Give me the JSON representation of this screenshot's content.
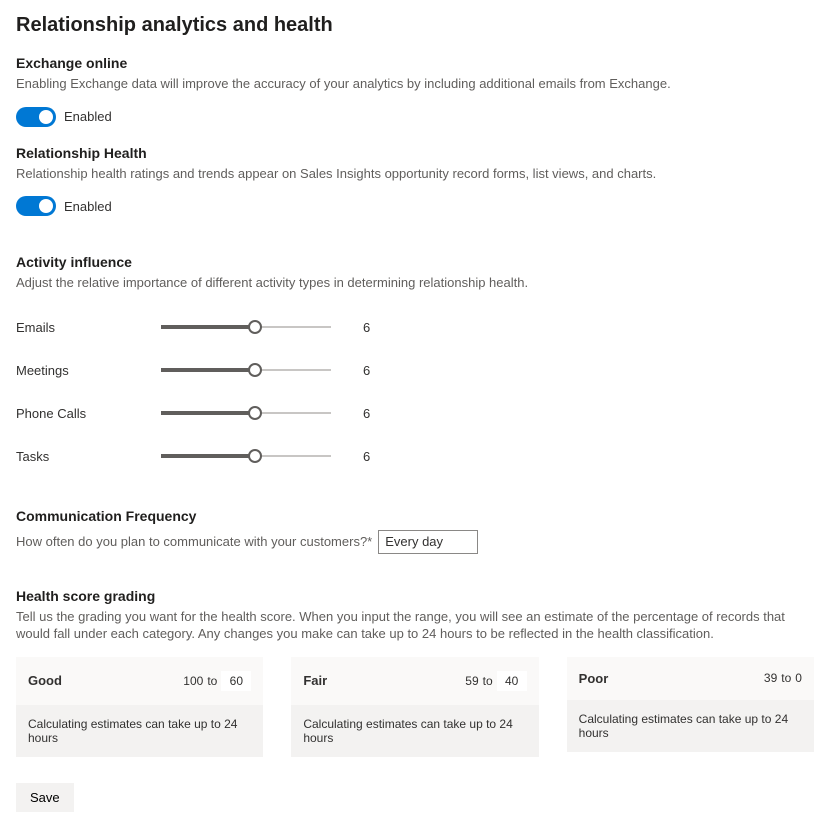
{
  "page_title": "Relationship analytics and health",
  "exchange": {
    "title": "Exchange online",
    "desc": "Enabling Exchange data will improve the accuracy of your analytics by including additional emails from Exchange.",
    "toggle_label": "Enabled"
  },
  "rel_health": {
    "title": "Relationship Health",
    "desc": "Relationship health ratings and trends appear on Sales Insights opportunity record forms, list views, and charts.",
    "toggle_label": "Enabled"
  },
  "activity": {
    "title": "Activity influence",
    "desc": "Adjust the relative importance of different activity types in determining relationship health.",
    "rows": [
      {
        "label": "Emails",
        "value": "6",
        "pct": 55
      },
      {
        "label": "Meetings",
        "value": "6",
        "pct": 55
      },
      {
        "label": "Phone Calls",
        "value": "6",
        "pct": 55
      },
      {
        "label": "Tasks",
        "value": "6",
        "pct": 55
      }
    ]
  },
  "comm": {
    "title": "Communication Frequency",
    "label": "How often do you plan to communicate with your customers?*",
    "value": "Every day"
  },
  "grading": {
    "title": "Health score grading",
    "desc": "Tell us the grading you want for the health score. When you input the range, you will see an estimate of the percentage of records that would fall under each category. Any changes you make can take up to 24 hours to be reflected in the health classification.",
    "estimate_text": "Calculating estimates can take up to 24 hours",
    "to_label": "to",
    "cards": [
      {
        "name": "Good",
        "from": "100",
        "to": "60",
        "to_editable": true
      },
      {
        "name": "Fair",
        "from": "59",
        "to": "40",
        "to_editable": true
      },
      {
        "name": "Poor",
        "from": "39",
        "to": "0",
        "to_editable": false
      }
    ]
  },
  "save_label": "Save"
}
